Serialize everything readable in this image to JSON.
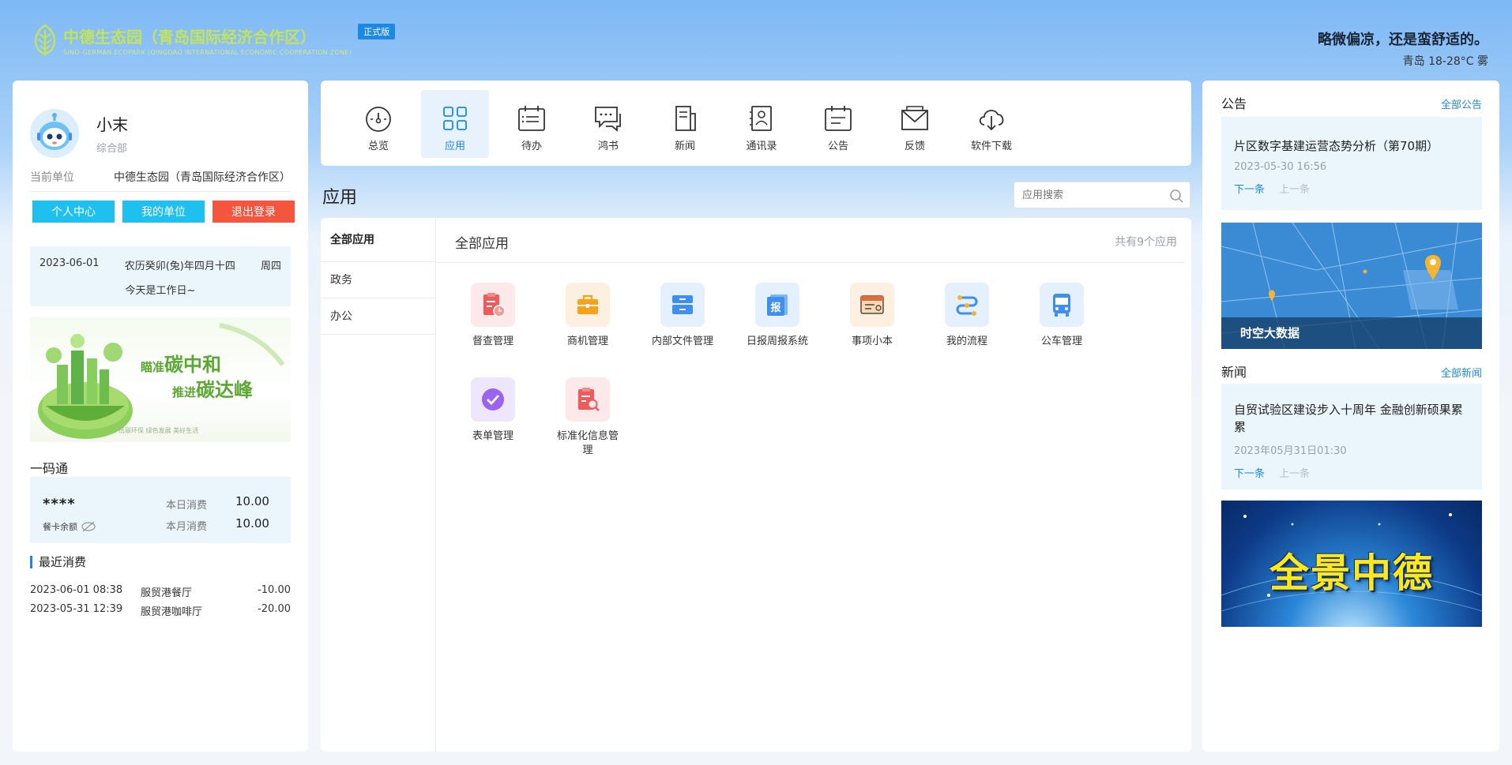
{
  "header": {
    "org_title": "中德生态园（青岛国际经济合作区）",
    "org_subtitle": "SINO-GERMAN ECOPARK (QINGDAO INTERNATIONAL ECONOMIC COOPERATION ZONE)",
    "edition_badge": "正式版",
    "weather_tip": "略微偏凉，还是蛮舒适的。",
    "weather_city": "青岛 18-28°C 雾"
  },
  "profile": {
    "name": "小末",
    "dept": "综合部",
    "unit_label": "当前单位",
    "unit_value": "中德生态园（青岛国际经济合作区）",
    "buttons": {
      "personal": "个人中心",
      "my_unit": "我的单位",
      "logout": "退出登录"
    }
  },
  "calendar": {
    "date": "2023-06-01",
    "lunar": "农历癸卯(兔)年四月十四",
    "weekday": "周四",
    "note": "今天是工作日~"
  },
  "banner_left": {
    "line1a": "瞄准",
    "line1b": "碳中和",
    "line2a": "推进",
    "line2b": "碳达峰",
    "caption": "低碳环保  绿色发展  美好生活"
  },
  "card": {
    "title": "一码通",
    "masked": "****",
    "balance_label": "餐卡余额",
    "today_label": "本日消费",
    "today_value": "10.00",
    "month_label": "本月消费",
    "month_value": "10.00"
  },
  "recent": {
    "title": "最近消费",
    "rows": [
      {
        "time": "2023-06-01 08:38",
        "place": "服贸港餐厅",
        "amount": "-10.00"
      },
      {
        "time": "2023-05-31 12:39",
        "place": "服贸港咖啡厅",
        "amount": "-20.00"
      }
    ]
  },
  "nav": {
    "items": [
      {
        "label": "总览",
        "icon": "dashboard-icon"
      },
      {
        "label": "应用",
        "icon": "apps-grid-icon",
        "active": true
      },
      {
        "label": "待办",
        "icon": "calendar-list-icon"
      },
      {
        "label": "鸿书",
        "icon": "chat-bubbles-icon"
      },
      {
        "label": "新闻",
        "icon": "news-icon"
      },
      {
        "label": "通讯录",
        "icon": "contacts-icon"
      },
      {
        "label": "公告",
        "icon": "notice-icon"
      },
      {
        "label": "反馈",
        "icon": "mail-icon"
      },
      {
        "label": "软件下载",
        "icon": "cloud-download-icon"
      }
    ]
  },
  "apps": {
    "title": "应用",
    "search_placeholder": "应用搜索",
    "categories": [
      "全部应用",
      "政务",
      "办公"
    ],
    "heading": "全部应用",
    "count": "共有9个应用",
    "items": [
      {
        "label": "督查管理",
        "icon": "inspection-icon",
        "color": "#f05a5a"
      },
      {
        "label": "商机管理",
        "icon": "briefcase-icon",
        "color": "#f5a31a"
      },
      {
        "label": "内部文件管理",
        "icon": "file-cabinet-icon",
        "color": "#3f8ff0"
      },
      {
        "label": "日报周报系统",
        "icon": "report-icon",
        "color": "#3f8ff0"
      },
      {
        "label": "事项小本",
        "icon": "notebook-icon",
        "color": "#e36a3b"
      },
      {
        "label": "我的流程",
        "icon": "workflow-icon",
        "color": "#3f8ff0"
      },
      {
        "label": "公车管理",
        "icon": "bus-icon",
        "color": "#3f8ff0"
      },
      {
        "label": "表单管理",
        "icon": "check-form-icon",
        "color": "#9a63f0"
      },
      {
        "label": "标准化信息管理",
        "icon": "standard-search-icon",
        "color": "#f05a5a"
      }
    ]
  },
  "announcements": {
    "title": "公告",
    "more": "全部公告",
    "item_title": "片区数字基建运营态势分析（第70期）",
    "item_date": "2023-05-30 16:56",
    "next": "下一条",
    "prev": "上一条"
  },
  "map_banner": {
    "caption": "时空大数据"
  },
  "news": {
    "title": "新闻",
    "more": "全部新闻",
    "item_title": "自贸试验区建设步入十周年 金融创新硕果累累",
    "item_date": "2023年05月31日01:30",
    "next": "下一条",
    "prev": "上一条"
  },
  "pano_banner": {
    "text": "全景中德"
  }
}
